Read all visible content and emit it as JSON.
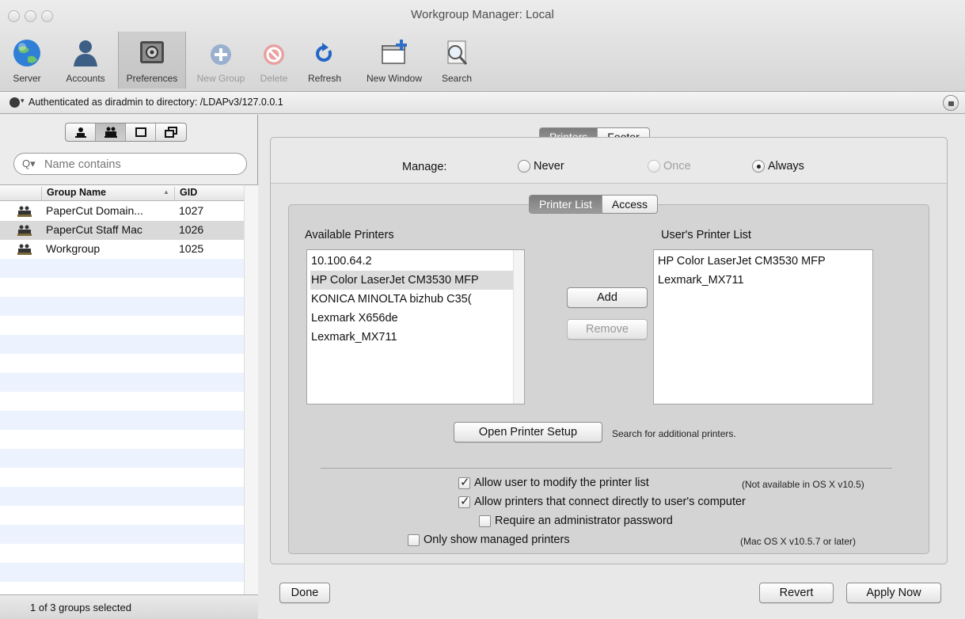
{
  "window": {
    "title": "Workgroup Manager: Local"
  },
  "toolbar": {
    "items": [
      {
        "label": "Server",
        "icon": "globe-icon"
      },
      {
        "label": "Accounts",
        "icon": "user-icon"
      },
      {
        "label": "Preferences",
        "icon": "preferences-icon"
      },
      {
        "label": "New Group",
        "icon": "add-icon"
      },
      {
        "label": "Delete",
        "icon": "delete-icon"
      },
      {
        "label": "Refresh",
        "icon": "refresh-icon"
      },
      {
        "label": "New Window",
        "icon": "new-window-icon"
      },
      {
        "label": "Search",
        "icon": "search-icon"
      }
    ]
  },
  "auth": {
    "text": "Authenticated as diradmin to directory: /LDAPv3/127.0.0.1"
  },
  "sidebar": {
    "search_placeholder": "Name contains",
    "columns": {
      "name": "Group Name",
      "gid": "GID"
    },
    "rows": [
      {
        "name": "PaperCut Domain...",
        "gid": "1027"
      },
      {
        "name": "PaperCut Staff Mac",
        "gid": "1026"
      },
      {
        "name": "Workgroup",
        "gid": "1025"
      }
    ],
    "status": "1 of 3 groups selected"
  },
  "tabs": {
    "printers": "Printers",
    "footer": "Footer"
  },
  "manage": {
    "label": "Manage:",
    "never": "Never",
    "once": "Once",
    "always": "Always"
  },
  "subtabs": {
    "printer_list": "Printer List",
    "access": "Access"
  },
  "available": {
    "label": "Available Printers",
    "items": [
      "10.100.64.2",
      "HP Color LaserJet CM3530 MFP",
      "KONICA MINOLTA bizhub C35(",
      "Lexmark X656de",
      "Lexmark_MX711"
    ]
  },
  "users_list": {
    "label": "User's Printer List",
    "items": [
      "HP Color LaserJet CM3530 MFP",
      "Lexmark_MX711"
    ]
  },
  "buttons": {
    "add": "Add",
    "remove": "Remove",
    "open_setup": "Open Printer Setup",
    "done": "Done",
    "revert": "Revert",
    "apply": "Apply Now"
  },
  "hints": {
    "search_additional": "Search for additional printers.",
    "not_available": "(Not available in OS X v10.5)",
    "mac_version": "(Mac OS X v10.5.7 or later)"
  },
  "options": {
    "allow_modify": "Allow user to modify the printer list",
    "allow_direct": "Allow printers that connect directly to user's computer",
    "require_admin": "Require an administrator password",
    "only_managed": "Only show managed printers"
  },
  "colors": {
    "selected_tab": "#8a8a8a",
    "list_alt_row": "#edf3fe"
  }
}
